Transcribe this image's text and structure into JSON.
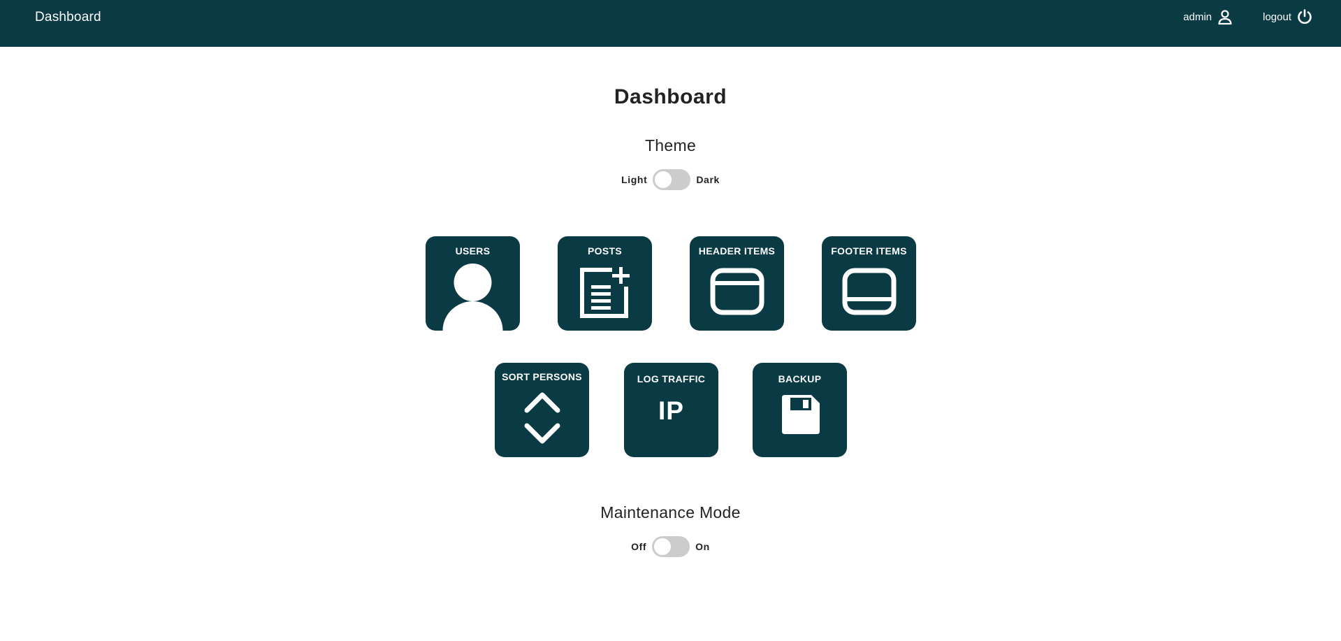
{
  "header": {
    "brand": "Dashboard",
    "user_label": "admin",
    "logout_label": "logout",
    "background_color": "#0a3a44"
  },
  "main": {
    "title": "Dashboard",
    "theme": {
      "title": "Theme",
      "left_label": "Light",
      "right_label": "Dark",
      "value": "Light"
    },
    "tiles_row1": [
      {
        "label": "USERS",
        "icon": "user-icon"
      },
      {
        "label": "POSTS",
        "icon": "post-add-icon"
      },
      {
        "label": "HEADER ITEMS",
        "icon": "header-window-icon"
      },
      {
        "label": "FOOTER ITEMS",
        "icon": "footer-window-icon"
      }
    ],
    "tiles_row2": [
      {
        "label": "SORT PERSONS",
        "icon": "sort-chevrons-icon"
      },
      {
        "label": "LOG TRAFFIC",
        "icon": "ip-icon",
        "icon_text": "IP"
      },
      {
        "label": "BACKUP",
        "icon": "floppy-disk-icon"
      }
    ],
    "maintenance": {
      "title": "Maintenance Mode",
      "left_label": "Off",
      "right_label": "On",
      "value": "Off"
    },
    "tile_color": "#0a3a44"
  }
}
